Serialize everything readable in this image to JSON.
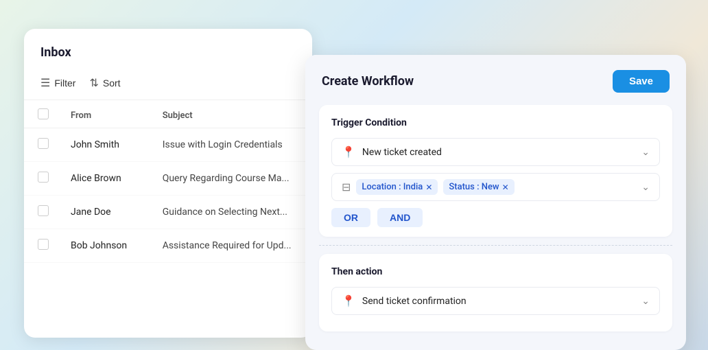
{
  "inbox": {
    "title": "Inbox",
    "toolbar": {
      "filter_label": "Filter",
      "sort_label": "Sort"
    },
    "table": {
      "headers": [
        "",
        "From",
        "Subject"
      ],
      "rows": [
        {
          "from": "John Smith",
          "subject": "Issue with Login Credentials"
        },
        {
          "from": "Alice Brown",
          "subject": "Query Regarding Course Ma..."
        },
        {
          "from": "Jane Doe",
          "subject": "Guidance on Selecting Next..."
        },
        {
          "from": "Bob Johnson",
          "subject": "Assistance Required for Upd..."
        }
      ]
    }
  },
  "workflow": {
    "title": "Create Workflow",
    "save_label": "Save",
    "trigger_section": {
      "title": "Trigger Condition",
      "trigger_value": "New ticket created",
      "filter_tags": [
        {
          "label": "Location : India",
          "id": "location"
        },
        {
          "label": "Status : New",
          "id": "status"
        }
      ],
      "logic_buttons": [
        "OR",
        "AND"
      ]
    },
    "action_section": {
      "title": "Then action",
      "action_value": "Send ticket confirmation"
    }
  }
}
